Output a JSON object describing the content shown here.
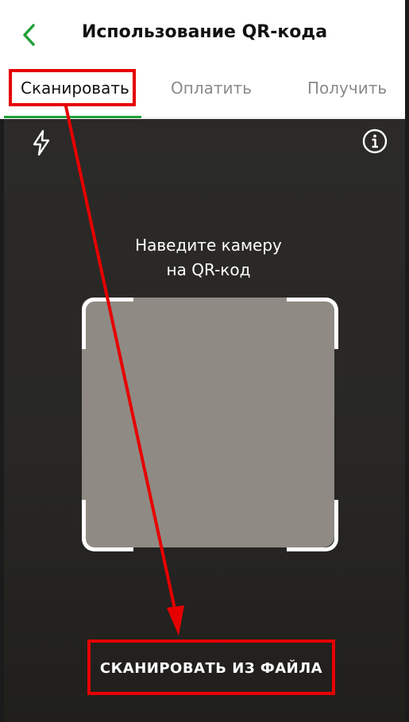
{
  "header": {
    "title": "Использование QR-кода",
    "back_icon": "chevron-left-icon"
  },
  "tabs": [
    {
      "label": "Сканировать",
      "active": true
    },
    {
      "label": "Оплатить",
      "active": false
    },
    {
      "label": "Получить",
      "active": false
    }
  ],
  "scanner": {
    "hint_line1": "Наведите камеру",
    "hint_line2": "на QR-код",
    "flash_icon": "flash-icon",
    "info_icon": "info-icon",
    "scan_from_file_label": "СКАНИРОВАТЬ ИЗ ФАЙЛА"
  },
  "colors": {
    "accent": "#21a038",
    "annotation": "#e60000"
  }
}
